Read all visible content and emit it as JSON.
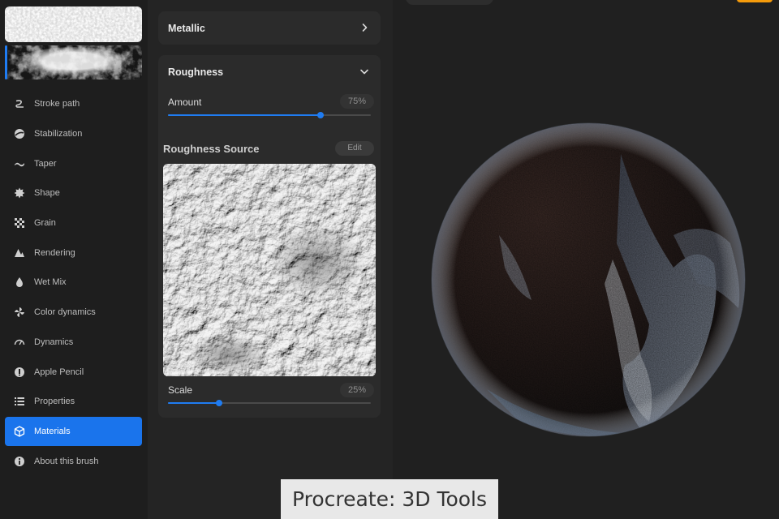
{
  "sidebar": {
    "items": [
      {
        "label": "Stroke path",
        "icon": "stroke-path-icon"
      },
      {
        "label": "Stabilization",
        "icon": "stabilization-icon"
      },
      {
        "label": "Taper",
        "icon": "taper-icon"
      },
      {
        "label": "Shape",
        "icon": "shape-icon"
      },
      {
        "label": "Grain",
        "icon": "grain-icon"
      },
      {
        "label": "Rendering",
        "icon": "rendering-icon"
      },
      {
        "label": "Wet Mix",
        "icon": "wet-mix-icon"
      },
      {
        "label": "Color dynamics",
        "icon": "color-dynamics-icon"
      },
      {
        "label": "Dynamics",
        "icon": "dynamics-icon"
      },
      {
        "label": "Apple Pencil",
        "icon": "apple-pencil-icon"
      },
      {
        "label": "Properties",
        "icon": "properties-icon"
      },
      {
        "label": "Materials",
        "icon": "materials-icon",
        "active": true
      },
      {
        "label": "About this brush",
        "icon": "info-icon"
      }
    ]
  },
  "panel": {
    "metallic": {
      "title": "Metallic",
      "icon": "chevron-right-icon"
    },
    "roughness": {
      "title": "Roughness",
      "icon": "chevron-down-icon",
      "amount": {
        "label": "Amount",
        "value_text": "75%",
        "value": 0.75
      },
      "source": {
        "title": "Roughness Source",
        "edit_label": "Edit"
      },
      "scale": {
        "label": "Scale",
        "value_text": "25%",
        "value": 0.25
      }
    }
  },
  "caption": "Procreate: 3D Tools",
  "colors": {
    "accent": "#1f7cf2",
    "active_item": "#1a74ec",
    "top_button": "#f59b0b"
  }
}
